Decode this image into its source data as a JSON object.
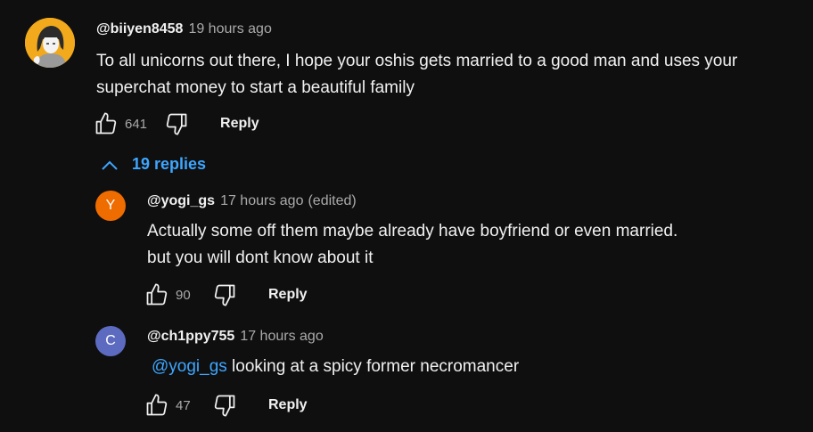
{
  "top_comment": {
    "author": "@biiyen8458",
    "time": "19 hours ago",
    "text_line1": "To all unicorns out there, I hope your oshis gets married to a good man and uses your",
    "text_line2": "superchat money to start a beautiful family",
    "likes": "641",
    "reply_label": "Reply",
    "avatar_icon": "anime-character-avatar"
  },
  "replies_toggle": {
    "label": "19 replies",
    "icon": "chevron-up-icon"
  },
  "replies": [
    {
      "author": "@yogi_gs",
      "time": "17 hours ago",
      "edited": "(edited)",
      "avatar_letter": "Y",
      "avatar_color": "#ef6c00",
      "text_line1": "Actually some off them maybe already have boyfriend or even married.",
      "text_line2": "but you will dont know about it",
      "likes": "90",
      "reply_label": "Reply"
    },
    {
      "author": "@ch1ppy755",
      "time": "17 hours ago",
      "avatar_letter": "C",
      "avatar_color": "#5c6bc0",
      "mention": "@yogi_gs",
      "text": " looking at a spicy former necromancer",
      "likes": "47",
      "reply_label": "Reply"
    }
  ],
  "colors": {
    "background": "#0f0f0f",
    "text": "#f1f1f1",
    "secondary_text": "#aaaaaa",
    "link": "#3ea6ff"
  }
}
